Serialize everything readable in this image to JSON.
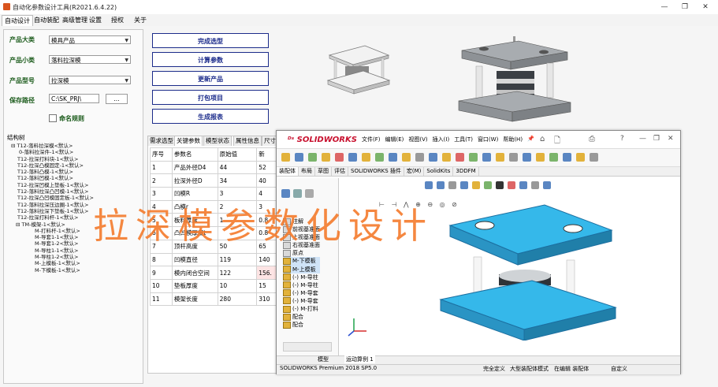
{
  "window": {
    "title": "自动化参数设计工具(R2021.6.4.22)",
    "controls": [
      "—",
      "❐",
      "✕"
    ]
  },
  "menu": [
    "自动设计",
    "自动装配",
    "高级管理",
    "设置",
    "授权",
    "关于"
  ],
  "form": {
    "category_label": "产品大类",
    "category_value": "模具产品",
    "subcategory_label": "产品小类",
    "subcategory_value": "落料拉深模",
    "model_label": "产品型号",
    "model_value": "拉深模",
    "save_label": "保存路径",
    "save_value": "C:\\SK_PRJ\\",
    "browse_label": "...",
    "rule_label": "命名规则"
  },
  "tree": {
    "title": "结构树",
    "items": [
      "T12-落料拉深模<默认>",
      "0-落料拉深件-1<默认>",
      "T12-拉深打料块-1<默认>",
      "T12-拉深凸模固定-1<默认>",
      "T12-落料凸模-1<默认>",
      "T12-落料凹模-1<默认>",
      "T12-拉深凹模上垫板-1<默认>",
      "T12-落料拉深凸凹模-1<默认>",
      "T12-拉深凸凹模固定板-1<默认>",
      "T12-落料拉深压边圈-1<默认>",
      "T12-落料拉深下垫板-1<默认>",
      "T12-拉深打料杆-1<默认>",
      "TM-模架-1<默认>",
      "M-打料杆-1<默认>",
      "M-导套1-1<默认>",
      "M-导套1-2<默认>",
      "M-导柱1-1<默认>",
      "M-导柱1-2<默认>",
      "M-上模板-1<默认>",
      "M-下模板-1<默认>"
    ]
  },
  "actions": [
    "完成选型",
    "计算参数",
    "更新产品",
    "打包项目",
    "生成报表"
  ],
  "tabs": [
    "需求选型",
    "关键参数",
    "模型状态",
    "属性信息",
    "尺寸"
  ],
  "table": {
    "headers": [
      "序号",
      "参数名",
      "原始值",
      "新"
    ],
    "rows": [
      [
        "1",
        "产品外径D4",
        "44",
        "52"
      ],
      [
        "2",
        "拉深外径D",
        "34",
        "40"
      ],
      [
        "3",
        "凹模R",
        "3",
        "4"
      ],
      [
        "4",
        "凸模r",
        "2",
        "3"
      ],
      [
        "5",
        "板料厚度",
        "1",
        "0.8"
      ],
      [
        "6",
        "凸凹模厚度t",
        "",
        "0.8"
      ],
      [
        "7",
        "顶杆高度",
        "50",
        "65"
      ],
      [
        "8",
        "凹模直径",
        "119",
        "140"
      ],
      [
        "9",
        "模内闭合空间",
        "122",
        "156."
      ],
      [
        "10",
        "垫板厚度",
        "10",
        "15"
      ],
      [
        "11",
        "模架长度",
        "280",
        "310"
      ]
    ]
  },
  "solidworks": {
    "logo": "SOLIDWORKS",
    "menu": [
      "文件(F)",
      "编辑(E)",
      "视图(V)",
      "插入(I)",
      "工具(T)",
      "窗口(W)",
      "帮助(H)"
    ],
    "tabs": [
      "装配体",
      "布局",
      "草图",
      "评估",
      "SOLIDWORKS 插件",
      "宏(M)",
      "SolidKits",
      "3DDFM"
    ],
    "tree": [
      "注解",
      "前视基准面",
      "上视基准面",
      "右视基准面",
      "原点",
      "M-下模板",
      "M-上模板",
      "(-) M-导柱",
      "(-) M-导柱",
      "(-) M-导套",
      "(-) M-导套",
      "(-) M-打料",
      "配合",
      "配合"
    ],
    "bottom_tabs": [
      "模型",
      "运动算例 1"
    ],
    "status": {
      "product": "SOLIDWORKS Premium 2018 SP5.0",
      "state": "完全定义",
      "mode": "大型装配体模式",
      "editing": "在编辑 装配体",
      "custom": "自定义"
    }
  },
  "overlay_text": "拉深模参数化设计",
  "colors": {
    "accent_btn": "#1a2a8a",
    "label_green": "#1a5a1a",
    "overlay": "#f47b2c",
    "plate_blue": "#35b8ea",
    "plate_gray": "#9aa0a6",
    "sw_red": "#c8102e"
  }
}
